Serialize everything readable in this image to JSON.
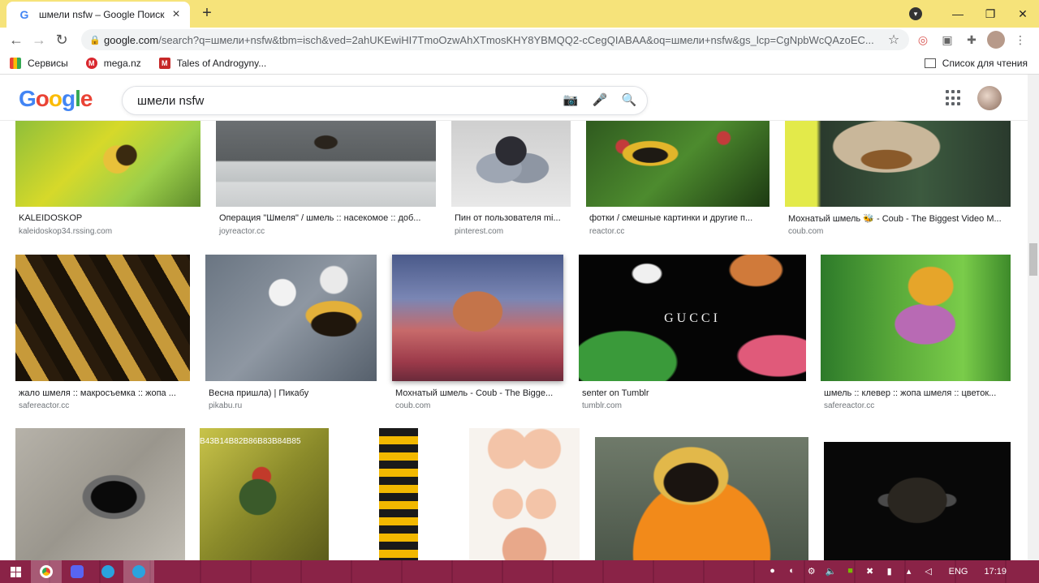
{
  "tab": {
    "title": "шмели nsfw – Google Поиск",
    "favicon": "G"
  },
  "window": {
    "minimize": "—",
    "maximize": "❐",
    "close": "✕"
  },
  "omnibox": {
    "host": "google.com",
    "path": "/search?q=шмели+nsfw&tbm=isch&ved=2ahUKEwiHI7TmoOzwAhXTmosKHY8YBMQQ2-cCegQIABAA&oq=шмели+nsfw&gs_lcp=CgNpbWcQAzoEC..."
  },
  "bookmarks": {
    "items": [
      {
        "label": "Сервисы"
      },
      {
        "label": "mega.nz",
        "icon_letter": "M"
      },
      {
        "label": "Tales of Androgyny...",
        "icon_letter": "M"
      }
    ],
    "reading_list": "Список для чтения"
  },
  "search": {
    "query": "шмели nsfw",
    "logo": [
      "G",
      "o",
      "o",
      "g",
      "l",
      "e"
    ]
  },
  "results": [
    {
      "caption": "KALEIDOSKOP",
      "domain": "kaleidoskop34.rssing.com"
    },
    {
      "caption": "Операция \"Шмеля\" / шмель :: насекомое :: доб...",
      "domain": "joyreactor.cc"
    },
    {
      "caption": "Пин от пользователя mi...",
      "domain": "pinterest.com"
    },
    {
      "caption": "фотки / смешные картинки и другие п...",
      "domain": "reactor.cc"
    },
    {
      "caption": "Мохнатый шмель 🐝 - Coub - The Biggest Video M...",
      "domain": "coub.com"
    },
    {
      "caption": "жало шмеля :: макросъемка :: жопа ...",
      "domain": "safereactor.cc"
    },
    {
      "caption": "Весна пришла) | Пикабу",
      "domain": "pikabu.ru"
    },
    {
      "caption": "Мохнатый шмель - Coub - The Bigge...",
      "domain": "coub.com"
    },
    {
      "caption": "senter on Tumblr",
      "domain": "tumblr.com",
      "overlay": "GUCCI"
    },
    {
      "caption": "шмель :: клевер :: жопа шмеля :: цветок...",
      "domain": "safereactor.cc"
    },
    {
      "caption": "",
      "domain": ""
    },
    {
      "caption": "",
      "domain": "",
      "overlay": "B43B14B82B86B83B84B85"
    },
    {
      "caption": "",
      "domain": ""
    },
    {
      "caption": "",
      "domain": ""
    },
    {
      "caption": "",
      "domain": ""
    },
    {
      "caption": "",
      "domain": ""
    }
  ],
  "taskbar": {
    "lang": "ENG",
    "time": "17:19"
  }
}
